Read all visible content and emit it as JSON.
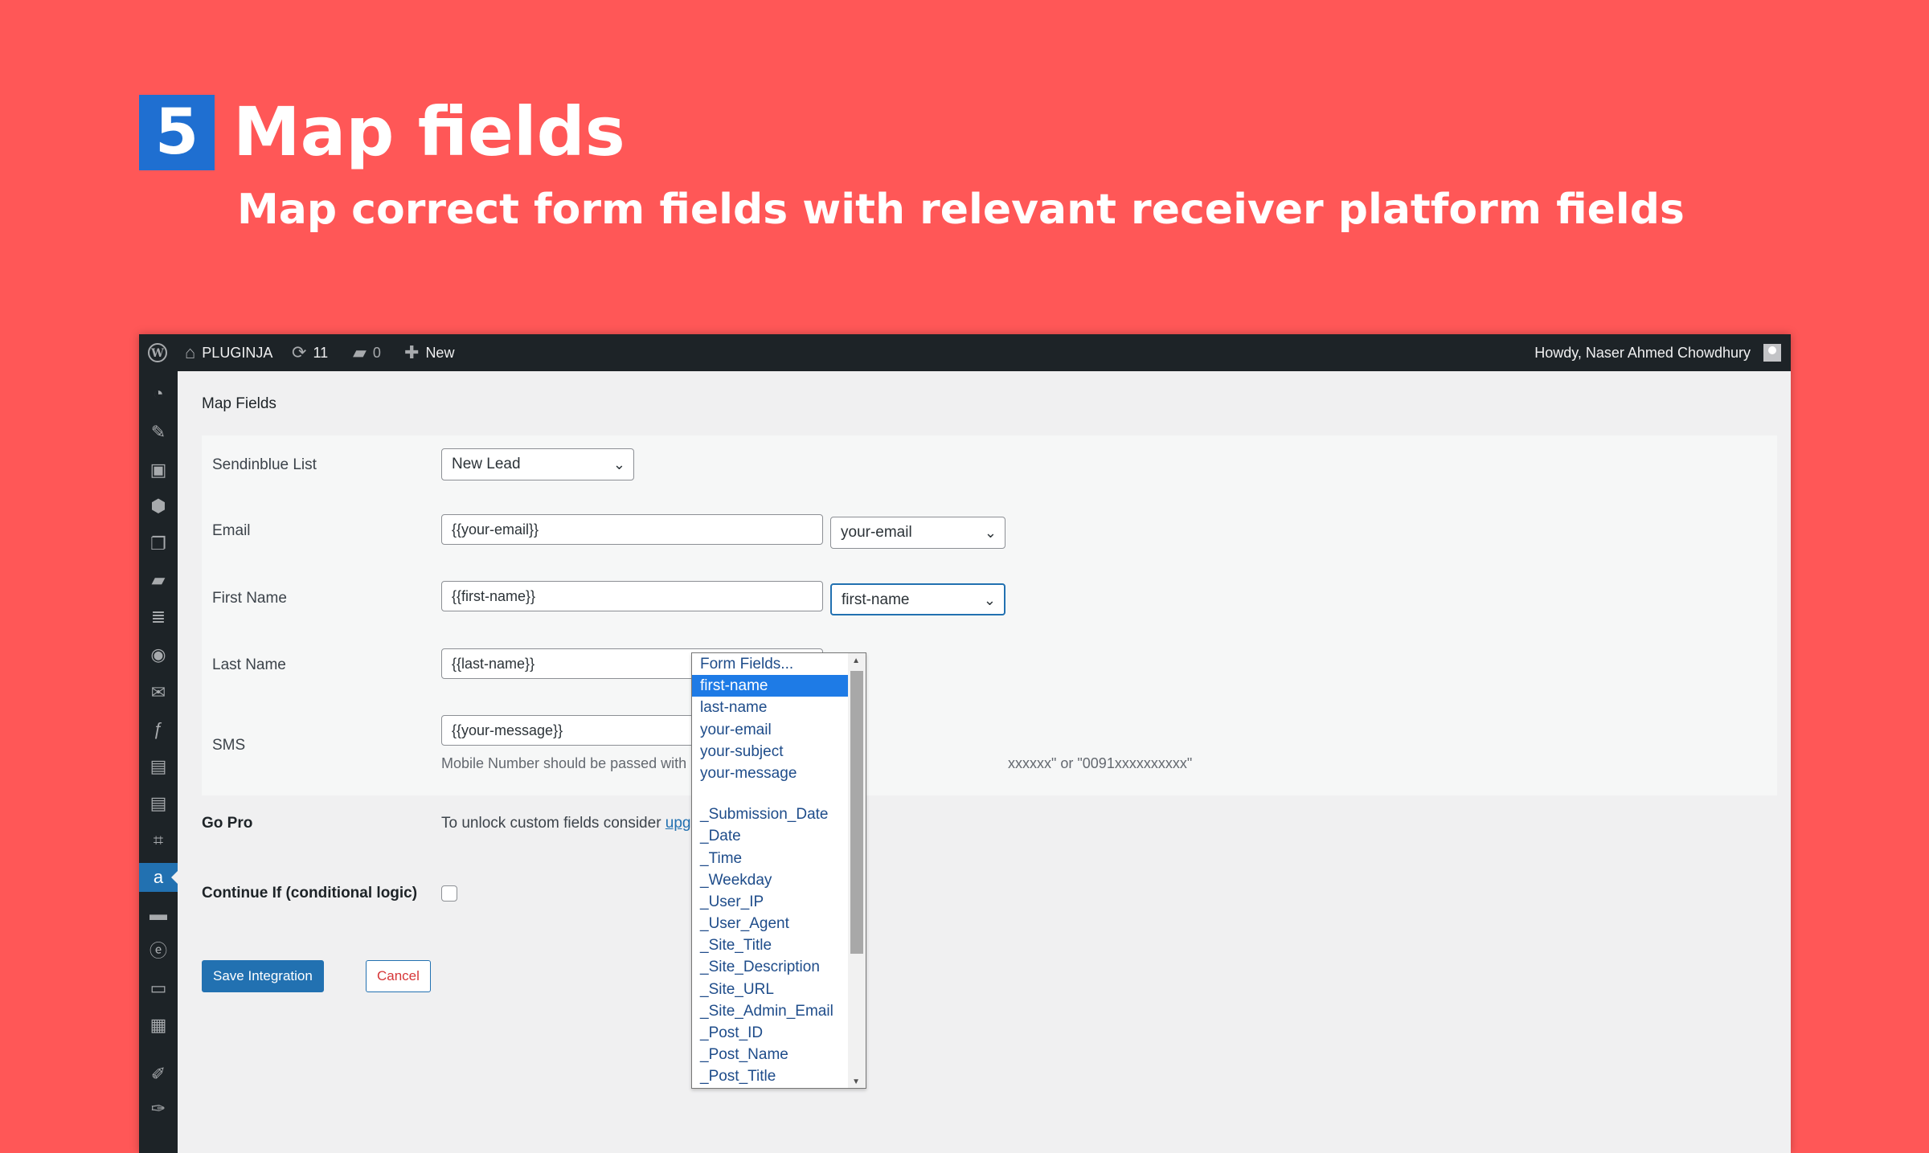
{
  "hero": {
    "step_number": "5",
    "title": "Map fields",
    "subtitle": "Map correct form fields with relevant receiver platform fields"
  },
  "admin_bar": {
    "site_name": "PLUGINJA",
    "updates_count": "11",
    "comments_count": "0",
    "new_label": "New",
    "greeting": "Howdy, Naser Ahmed Chowdhury"
  },
  "page": {
    "title": "Map Fields"
  },
  "form": {
    "list": {
      "label": "Sendinblue List",
      "value": "New Lead"
    },
    "email": {
      "label": "Email",
      "value": "{{your-email}}",
      "select": "your-email"
    },
    "first_name": {
      "label": "First Name",
      "value": "{{first-name}}",
      "select": "first-name"
    },
    "last_name": {
      "label": "Last Name",
      "value": "{{last-name}}"
    },
    "sms": {
      "label": "SMS",
      "value": "{{your-message}}",
      "help_left": "Mobile Number should be passed with proper country co",
      "help_right": "xxxxxx\" or \"0091xxxxxxxxxx\""
    },
    "gopro": {
      "label": "Go Pro",
      "text_before": "To unlock custom fields consider ",
      "link": "upgrading to Pro",
      "text_after": "."
    },
    "conditional": {
      "label": "Continue If (conditional logic)"
    },
    "save_label": "Save Integration",
    "cancel_label": "Cancel"
  },
  "dropdown": {
    "selected": "first-name",
    "items_top": [
      "Form Fields...",
      "first-name",
      "last-name",
      "your-email",
      "your-subject",
      "your-message"
    ],
    "items_special": [
      "_Submission_Date",
      "_Date",
      "_Time",
      "_Weekday",
      "_User_IP",
      "_User_Agent",
      "_Site_Title",
      "_Site_Description",
      "_Site_URL",
      "_Site_Admin_Email",
      "_Post_ID",
      "_Post_Name",
      "_Post_Title"
    ]
  },
  "colors": {
    "background": "#ff5757",
    "step_badge": "#1f6fd1",
    "admin_bar": "#1d2327",
    "primary": "#2271b1",
    "cancel_text": "#d63638"
  }
}
